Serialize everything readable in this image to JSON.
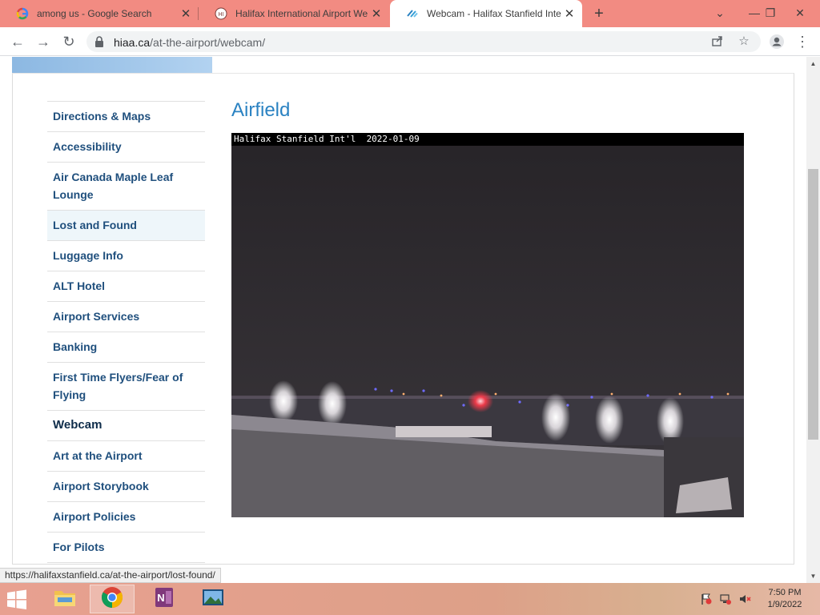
{
  "browser": {
    "tabs": [
      {
        "title": "among us - Google Search",
        "icon": "google-g-icon",
        "active": false
      },
      {
        "title": "Halifax International Airport Web",
        "icon": "hiaa-logo-icon",
        "active": false
      },
      {
        "title": "Webcam - Halifax Stanfield Intern",
        "icon": "hiaa-wave-icon",
        "active": true
      }
    ],
    "new_tab_label": "+",
    "window_controls": {
      "tab_search": "⌄",
      "minimize": "—",
      "restore": "❐",
      "close": "✕"
    },
    "nav": {
      "back": "←",
      "forward": "→",
      "reload": "↻"
    },
    "address": {
      "host": "hiaa.ca",
      "path": "/at-the-airport/webcam/"
    }
  },
  "sidebar": {
    "items": [
      {
        "label": "Directions & Maps"
      },
      {
        "label": "Accessibility"
      },
      {
        "label": "Air Canada Maple Leaf Lounge"
      },
      {
        "label": "Lost and Found"
      },
      {
        "label": "Luggage Info"
      },
      {
        "label": "ALT Hotel"
      },
      {
        "label": "Airport Services"
      },
      {
        "label": "Banking"
      },
      {
        "label": "First Time Flyers/Fear of Flying"
      },
      {
        "label": "Webcam"
      },
      {
        "label": "Art at the Airport"
      },
      {
        "label": "Airport Storybook"
      },
      {
        "label": "Airport Policies"
      },
      {
        "label": "For Pilots"
      }
    ],
    "hovered_index": 3,
    "active_index": 9
  },
  "main": {
    "heading": "Airfield",
    "webcam": {
      "caption": "Halifax Stanfield Int'l  2022-01-09"
    }
  },
  "status_url": "https://halifaxstanfield.ca/at-the-airport/lost-found/",
  "taskbar": {
    "apps": [
      {
        "name": "file-explorer",
        "icon": "folder-icon"
      },
      {
        "name": "chrome",
        "icon": "chrome-icon",
        "active": true
      },
      {
        "name": "onenote",
        "icon": "onenote-icon"
      },
      {
        "name": "photos",
        "icon": "photos-icon"
      }
    ],
    "time": "7:50 PM",
    "date": "1/9/2022"
  },
  "colors": {
    "tab_strip": "#f28b82",
    "nav_link": "#1f4f7d",
    "heading": "#2a82c2"
  }
}
